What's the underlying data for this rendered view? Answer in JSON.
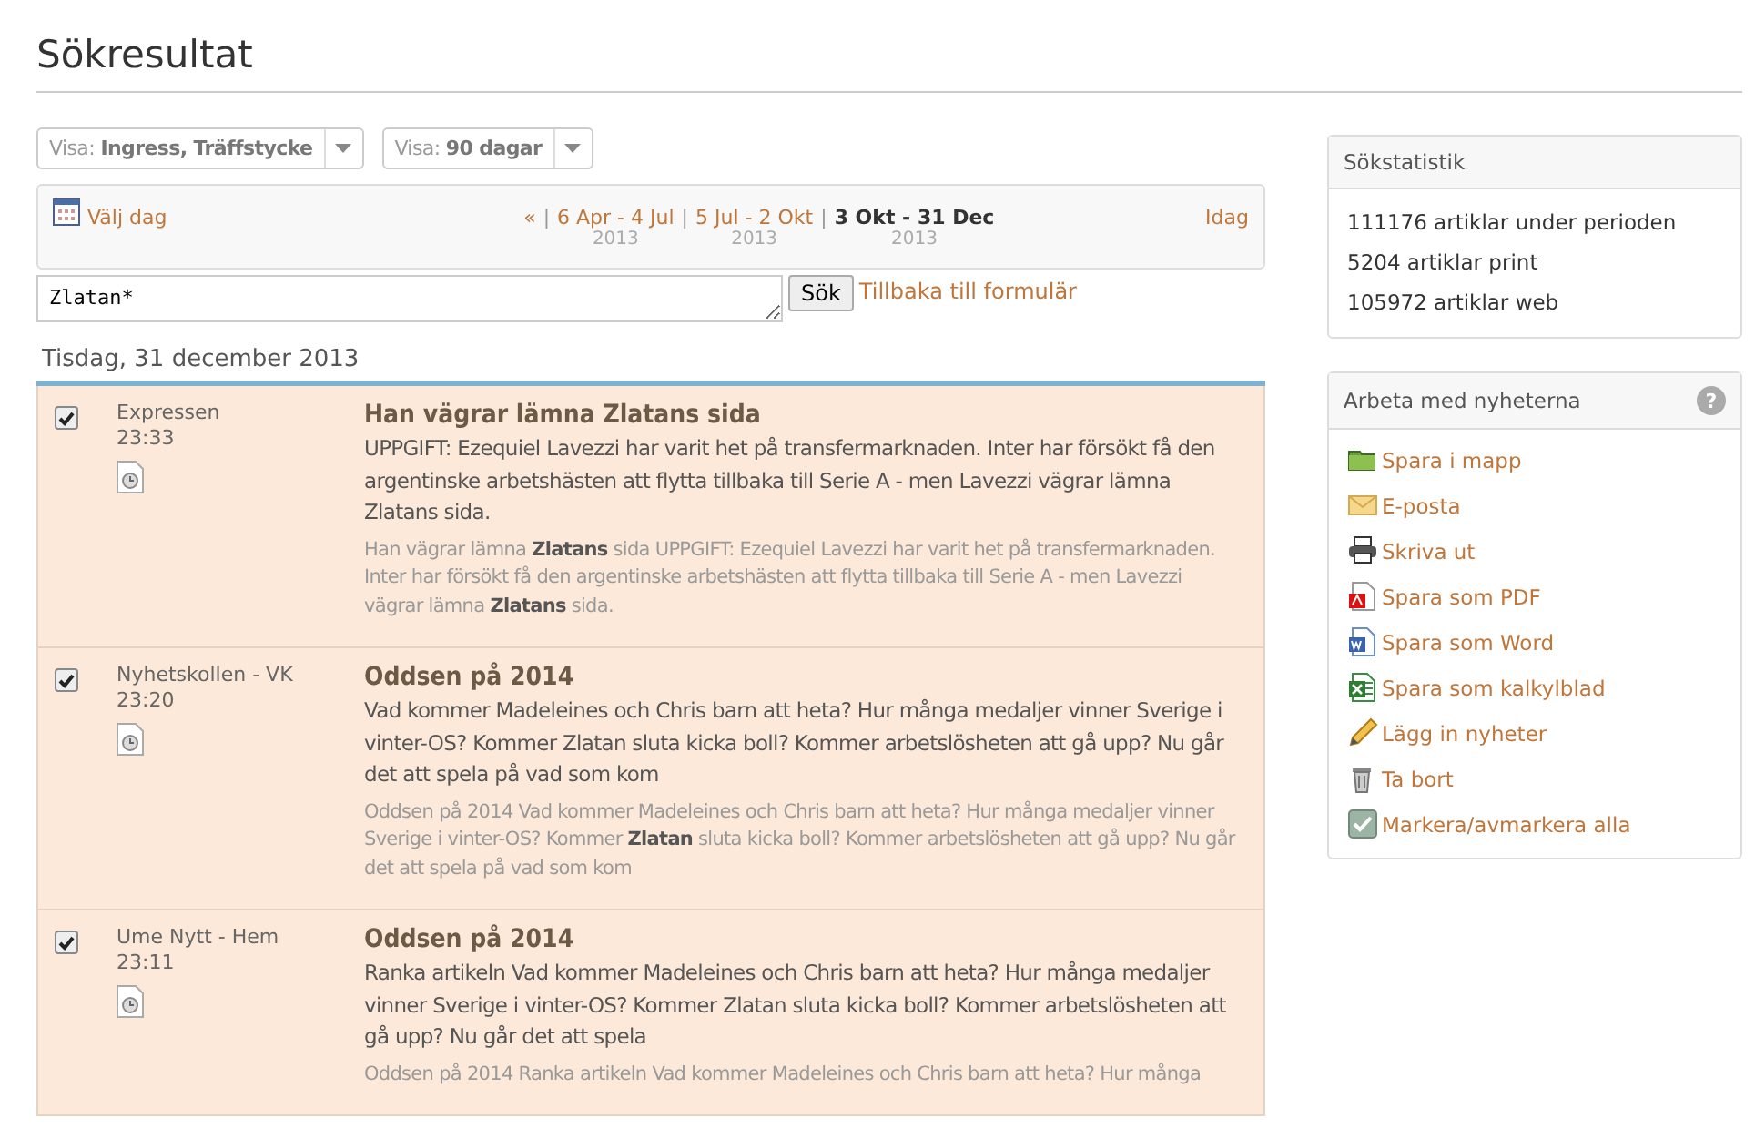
{
  "page_title": "Sökresultat",
  "filters": [
    {
      "label": "Visa:",
      "value": "Ingress, Träffstycke"
    },
    {
      "label": "Visa:",
      "value": "90 dagar"
    }
  ],
  "date_nav": {
    "pick_day": "Välj dag",
    "prev": "«",
    "separator": "|",
    "ranges": [
      {
        "label": "6 Apr - 4 Jul",
        "year": "2013",
        "selected": false
      },
      {
        "label": "5 Jul - 2 Okt",
        "year": "2013",
        "selected": false
      },
      {
        "label": "3 Okt - 31 Dec",
        "year": "2013",
        "selected": true
      }
    ],
    "today": "Idag"
  },
  "search": {
    "value": "Zlatan*",
    "button": "Sök",
    "back_link": "Tillbaka till formulär"
  },
  "date_heading": "Tisdag, 31 december 2013",
  "results": [
    {
      "checked": true,
      "source": "Expressen",
      "time": "23:33",
      "title": "Han vägrar lämna Zlatans sida",
      "lead": "UPPGIFT: Ezequiel Lavezzi har varit het på transfermarknaden. Inter har försökt få den argentinske arbetshästen att flytta tillbaka till Serie A - men Lavezzi vägrar lämna Zlatans sida.",
      "snippet": "Han vägrar lämna **Zlatans** sida UPPGIFT: Ezequiel Lavezzi har varit het på transfermarknaden. Inter har försökt få den argentinske arbetshästen att flytta tillbaka till Serie A - men Lavezzi vägrar lämna **Zlatans** sida."
    },
    {
      "checked": true,
      "source": "Nyhetskollen - VK",
      "time": "23:20",
      "title": "Oddsen på 2014",
      "lead": "Vad kommer Madeleines och Chris barn att heta? Hur många medaljer vinner Sverige i vinter-OS? Kommer Zlatan sluta kicka boll? Kommer arbetslösheten att gå upp? Nu går det att spela på vad som kom",
      "snippet": "Oddsen på 2014 Vad kommer Madeleines och Chris barn att heta? Hur många medaljer vinner Sverige i vinter-OS? Kommer **Zlatan** sluta kicka boll? Kommer arbetslösheten att gå upp? Nu går det att spela på vad som kom"
    },
    {
      "checked": true,
      "source": "Ume Nytt - Hem",
      "time": "23:11",
      "title": "Oddsen på 2014",
      "lead": "Ranka artikeln Vad kommer Madeleines och Chris barn att heta? Hur många medaljer vinner Sverige i vinter-OS? Kommer Zlatan sluta kicka boll? Kommer arbetslösheten att gå upp? Nu går det att spela",
      "snippet": "Oddsen på 2014 Ranka artikeln Vad kommer Madeleines och Chris barn att heta? Hur många"
    }
  ],
  "stats": {
    "title": "Sökstatistik",
    "lines": [
      "111176 artiklar under perioden",
      "5204 artiklar print",
      "105972 artiklar web"
    ]
  },
  "actions": {
    "title": "Arbeta med nyheterna",
    "help": "?",
    "items": [
      {
        "kind": "folder",
        "label": "Spara i mapp"
      },
      {
        "kind": "mail",
        "label": "E-posta"
      },
      {
        "kind": "print",
        "label": "Skriva ut"
      },
      {
        "kind": "pdf",
        "label": "Spara som PDF"
      },
      {
        "kind": "word",
        "label": "Spara som Word"
      },
      {
        "kind": "excel",
        "label": "Spara som kalkylblad"
      },
      {
        "kind": "pencil",
        "label": "Lägg in nyheter"
      },
      {
        "kind": "trash",
        "label": "Ta bort"
      },
      {
        "kind": "check",
        "label": "Markera/avmarkera alla"
      }
    ]
  }
}
